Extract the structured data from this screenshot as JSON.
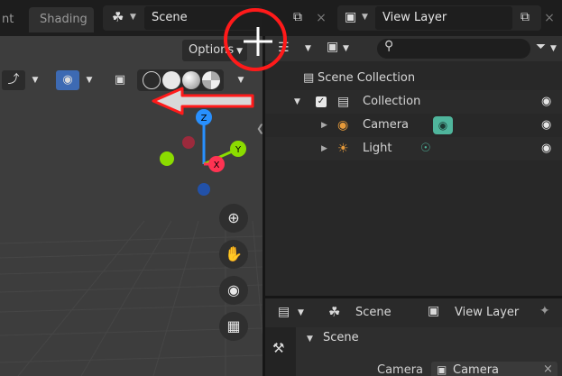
{
  "topbar": {
    "tab_layout_partial": "nt",
    "tab_shading": "Shading",
    "scene_label": "Scene",
    "view_layer_label": "View Layer",
    "copy_glyph": "⧉",
    "close_glyph": "×"
  },
  "viewport": {
    "options_label": "Options",
    "gizmo_axes": {
      "x": "X",
      "y": "Y",
      "z": "Z"
    },
    "nav_buttons": [
      {
        "name": "zoom",
        "icon": "zoom-icon"
      },
      {
        "name": "pan",
        "icon": "hand-icon"
      },
      {
        "name": "camera-view",
        "icon": "camera-icon"
      },
      {
        "name": "perspective",
        "icon": "grid-icon"
      }
    ]
  },
  "outliner": {
    "rows": [
      {
        "label": "Scene Collection",
        "icon": "scene-collection-icon"
      },
      {
        "label": "Collection",
        "icon": "collection-icon",
        "checked": true
      },
      {
        "label": "Camera",
        "icon": "camera-object-icon",
        "data_icon": "camera-data-icon"
      },
      {
        "label": "Light",
        "icon": "light-object-icon",
        "data_icon": "light-data-icon"
      }
    ]
  },
  "properties": {
    "scene_label": "Scene",
    "view_layer_label": "View Layer",
    "panel_title": "Scene",
    "camera_label": "Camera",
    "camera_value": "Camera"
  },
  "colors": {
    "annotation_red": "#ff1a1a",
    "axis_x": "#ff3352",
    "axis_y": "#8bdc00",
    "axis_z": "#2890ff",
    "camera_orange": "#e69a3a",
    "data_teal": "#4fb59c"
  }
}
